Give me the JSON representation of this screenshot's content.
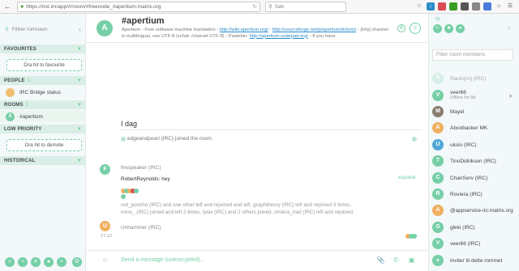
{
  "browser": {
    "url": "https://riot.im/app/#/room/#freenode_#apertium:matrix.org",
    "search_placeholder": "Søk"
  },
  "left_panel": {
    "filter_placeholder": "Filtrer romnavn",
    "sections": {
      "favourites": {
        "label": "FAVOURITES",
        "drop_label": "Dra hit to favourite"
      },
      "people": {
        "label": "PEOPLE",
        "count": "1",
        "items": [
          {
            "name": "IRC Bridge status"
          }
        ]
      },
      "rooms": {
        "label": "ROOMS",
        "count": "1",
        "items": [
          {
            "name": "#apertium",
            "avatar_letter": "A"
          }
        ]
      },
      "low_priority": {
        "label": "LOW PRIORITY",
        "drop_label": "Dra hit to demote"
      },
      "historical": {
        "label": "HISTORICAL"
      }
    }
  },
  "room": {
    "avatar_letter": "A",
    "name": "#apertium",
    "topic_parts": [
      "Apertium - Free software machine translation - ",
      "http://wiki.apertium.org/",
      " - ",
      "http://sourceforge.net/p/apertium/tickets/",
      " - [ś≠ʂ] channel is multilingual, use UTF-8 (xchat: /charset UTF-8) - Pastebin: ",
      "http://apertium.codepad.org/",
      " - If you have"
    ]
  },
  "timeline": {
    "date_separator": "I dag",
    "join_event": "edgeandpearl (IRC) joined the room.",
    "message1": {
      "avatar_letter": "F",
      "sender": "firespeaker (IRC)",
      "body": "RobertReynolds: hey"
    },
    "expand_label": "expand",
    "summary": "red_poncho (IRC) and one other left and rejoined and left, graphtheory (IRC) left and rejoined 3 times, irene_ (IRC) joined and left 2 times, lylax (IRC) and 2 others joined, mniera_trad (IRC) left and rejoined",
    "message2": {
      "avatar_letter": "U",
      "sender": "Unhammer (IRC)",
      "timestamp": "17:13"
    }
  },
  "composer": {
    "placeholder": "Send a message (unencrypted)..."
  },
  "right_panel": {
    "member_count": "55",
    "filter_placeholder": "Filter room members",
    "members": [
      {
        "name": "Racks[m] (IRC)",
        "letter": "R",
        "color": "#b9e5d2",
        "faded": true
      },
      {
        "name": "veer66",
        "sub": "Offline for 8d",
        "letter": "V",
        "color": "#76cfa6"
      },
      {
        "name": "Mayel",
        "letter": "M",
        "color": "#8a7d6e"
      },
      {
        "name": "Aboobacker MK",
        "letter": "A",
        "color": "#f0b060"
      },
      {
        "name": "uksio (IRC)",
        "letter": "U",
        "color": "#50a8d8"
      },
      {
        "name": "TinoDidriksen (IRC)",
        "letter": "T",
        "color": "#76cfa6"
      },
      {
        "name": "ChanServ (IRC)",
        "letter": "C",
        "color": "#76cfa6"
      },
      {
        "name": "Roviera (IRC)",
        "letter": "R",
        "color": "#76cfa6"
      },
      {
        "name": "@appservice-irc:matrix.org",
        "letter": "A",
        "color": "#f0b060"
      },
      {
        "name": "gleki (IRC)",
        "letter": "G",
        "color": "#76cfa6"
      },
      {
        "name": "veer66 (IRC)",
        "letter": "V",
        "color": "#76cfa6"
      }
    ],
    "invite_label": "Inviter til dette rommet"
  },
  "colors": {
    "accent": "#76cfa6",
    "link": "#2a8bc9"
  }
}
